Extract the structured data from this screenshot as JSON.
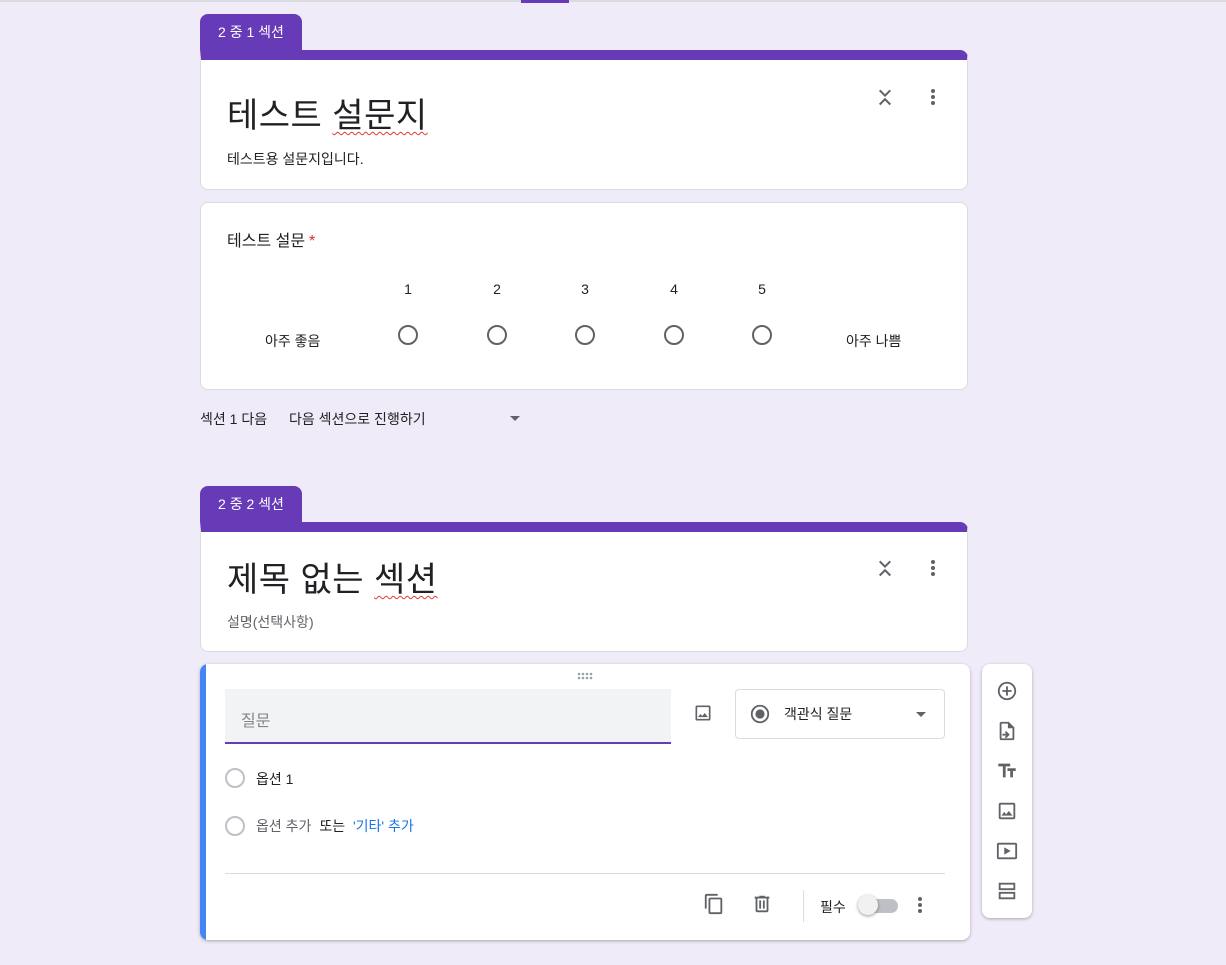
{
  "section1": {
    "tab": "2 중 1 섹션",
    "title_part1": "테스트 ",
    "title_part2": "설문지",
    "description": "테스트용 설문지입니다."
  },
  "question1": {
    "title": "테스트 설문",
    "required_mark": "*",
    "scale": [
      "1",
      "2",
      "3",
      "4",
      "5"
    ],
    "low_label": "아주 좋음",
    "high_label": "아주 나쁨"
  },
  "after_section": {
    "label": "섹션 1 다음",
    "value": "다음 섹션으로 진행하기"
  },
  "section2": {
    "tab": "2 중 2 섹션",
    "title_part1": "제목 없는 ",
    "title_part2": "섹션",
    "description_placeholder": "설명(선택사항)"
  },
  "editor": {
    "question_placeholder": "질문",
    "question_type": "객관식 질문",
    "option1": "옵션 1",
    "add_option": "옵션 추가",
    "or": "또는",
    "add_other": "'기타' 추가",
    "required_label": "필수",
    "required_on": false
  },
  "colors": {
    "background": "#f0ebf8",
    "accent": "#673ab7",
    "active_bar": "#4285f4",
    "link": "#1a73e8",
    "required": "#d93025"
  },
  "icons": {
    "collapse": "collapse-icon",
    "more": "more-vert-icon",
    "image": "image-icon",
    "radio": "radio-button-icon",
    "add": "add-circle-icon",
    "import": "import-questions-icon",
    "title": "title-text-icon",
    "video": "video-icon",
    "section": "section-icon",
    "copy": "copy-icon",
    "delete": "delete-icon",
    "drag": "drag-handle-icon"
  }
}
